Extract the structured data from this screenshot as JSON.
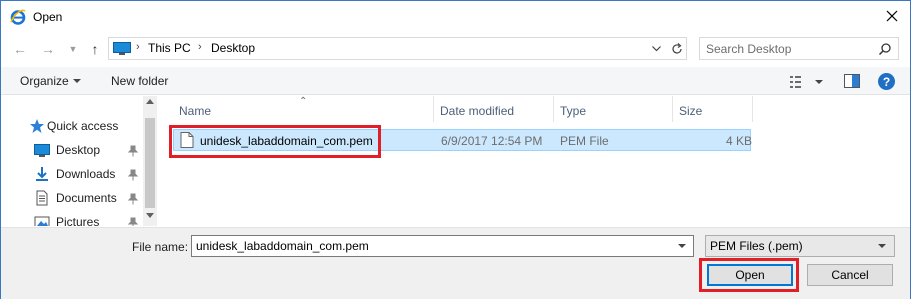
{
  "window": {
    "title": "Open"
  },
  "address": {
    "crumbs": [
      "This PC",
      "Desktop"
    ]
  },
  "search": {
    "placeholder": "Search Desktop"
  },
  "toolbar": {
    "organize": "Organize",
    "new_folder": "New folder"
  },
  "navpane": {
    "items": [
      {
        "label": "Quick access",
        "icon": "star-icon",
        "pinned": false
      },
      {
        "label": "Desktop",
        "icon": "desktop-folder-icon",
        "pinned": true
      },
      {
        "label": "Downloads",
        "icon": "downloads-folder-icon",
        "pinned": true
      },
      {
        "label": "Documents",
        "icon": "documents-folder-icon",
        "pinned": true
      },
      {
        "label": "Pictures",
        "icon": "pictures-folder-icon",
        "pinned": true
      }
    ]
  },
  "columns": [
    "Name",
    "Date modified",
    "Type",
    "Size"
  ],
  "files": [
    {
      "name": "unidesk_labaddomain_com.pem",
      "date": "6/9/2017 12:54 PM",
      "type": "PEM File",
      "size": "4 KB",
      "selected": true
    }
  ],
  "bottom": {
    "filename_label": "File name:",
    "filename_value": "unidesk_labaddomain_com.pem",
    "filetype_value": "PEM Files (.pem)",
    "open_label": "Open",
    "cancel_label": "Cancel"
  },
  "colors": {
    "accent": "#0078d7",
    "highlight": "#e21f26",
    "selection": "#cce8ff"
  }
}
